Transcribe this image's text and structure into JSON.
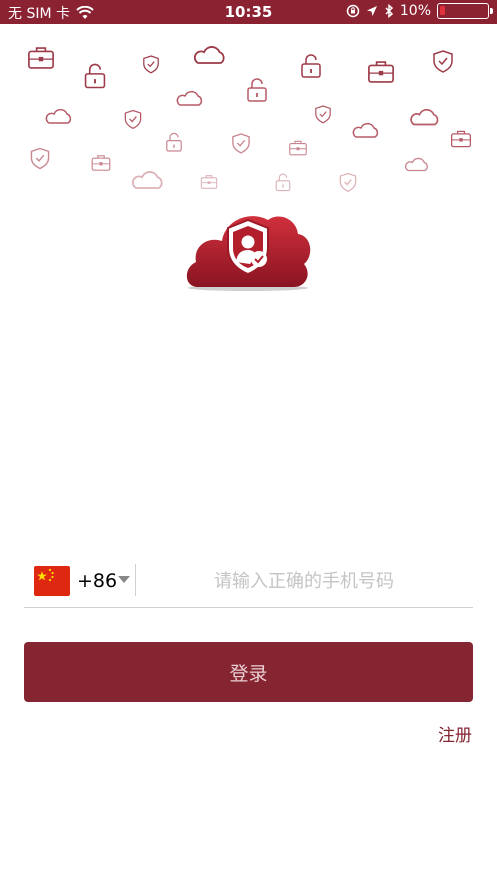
{
  "status_bar": {
    "carrier": "无 SIM 卡",
    "time": "10:35",
    "battery": "10%",
    "battery_level": 0.1,
    "icons": [
      "wifi-icon",
      "orientation-lock-icon",
      "location-icon",
      "bluetooth-icon",
      "battery-icon"
    ]
  },
  "logo": {
    "icon": "cloud-shield-user-icon"
  },
  "phone_login": {
    "flag_icon": "china-flag-icon",
    "country_code": "+86",
    "phone_placeholder": "请输入正确的手机号码"
  },
  "login_button": {
    "label": "登录"
  },
  "register_link": {
    "label": "注册"
  },
  "colors": {
    "brand": "#852532",
    "status_bar": "#8b2232"
  }
}
